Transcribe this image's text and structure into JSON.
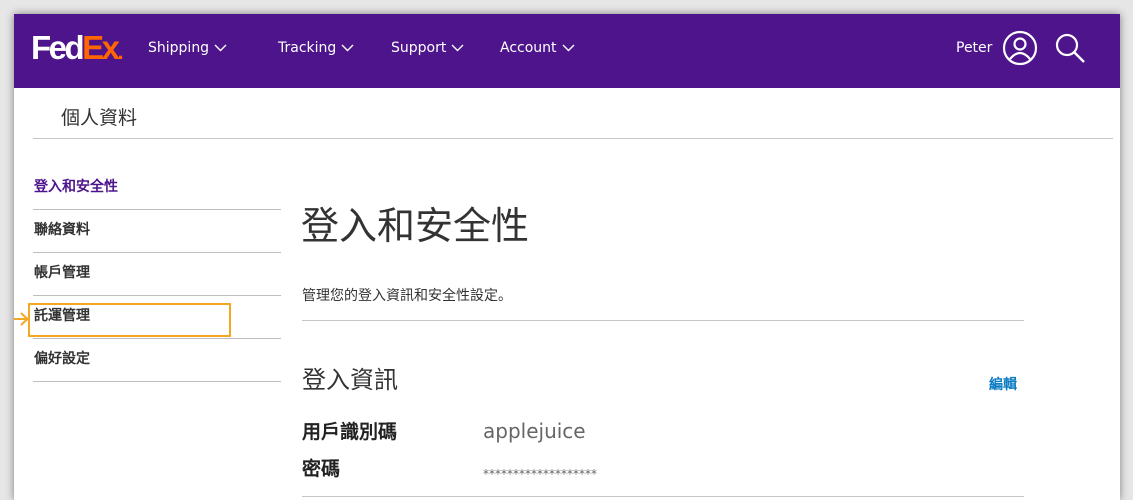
{
  "header": {
    "logo": {
      "fed": "Fed",
      "ex": "Ex",
      "dot": "."
    },
    "nav": [
      {
        "label": "Shipping"
      },
      {
        "label": "Tracking"
      },
      {
        "label": "Support"
      },
      {
        "label": "Account"
      }
    ],
    "user_name": "Peter",
    "icons": {
      "user": "user-circle-icon",
      "search": "search-icon",
      "chevron": "chevron-down-icon"
    },
    "colors": {
      "brand_purple": "#4d148c",
      "brand_orange": "#ff6600"
    }
  },
  "page": {
    "title": "個人資料"
  },
  "sidebar": {
    "items": [
      {
        "label": "登入和安全性",
        "active": true
      },
      {
        "label": "聯絡資料"
      },
      {
        "label": "帳戶管理"
      },
      {
        "label": "託運管理",
        "highlighted": true
      },
      {
        "label": "偏好設定"
      }
    ],
    "active_color": "#4d148c",
    "highlight_color": "#f5a623"
  },
  "main": {
    "heading": "登入和安全性",
    "subtitle": "管理您的登入資訊和安全性設定。",
    "section_title": "登入資訊",
    "edit_label": "編輯",
    "fields": [
      {
        "label": "用戶識別碼",
        "value": "applejuice"
      },
      {
        "label": "密碼",
        "value": "*******************"
      }
    ],
    "link_color": "#0b7bc2"
  }
}
